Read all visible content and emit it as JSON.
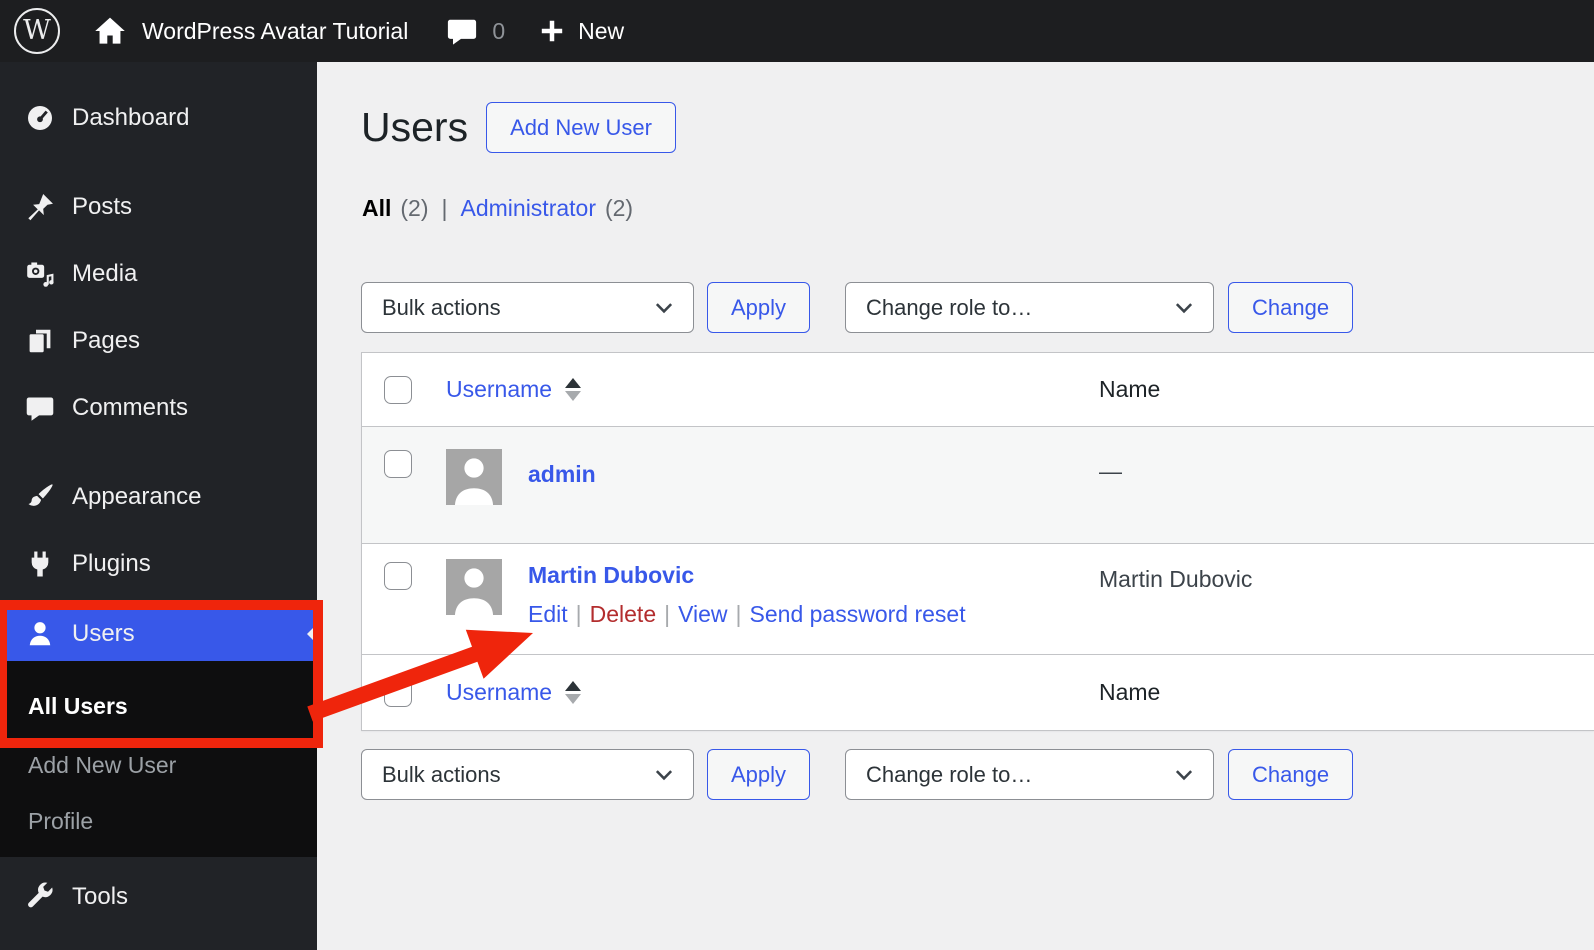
{
  "colors": {
    "accent": "#3858e9",
    "delete_red": "#b32d2e",
    "annotation_red": "#ef250c",
    "admin_bar_bg": "#1d1e20",
    "sidebar_bg": "#212327",
    "submenu_bg": "#0e0e0f",
    "content_bg": "#f0f0f1"
  },
  "admin_bar": {
    "site_name": "WordPress Avatar Tutorial",
    "comments_count": "0",
    "new_label": "New"
  },
  "sidebar": {
    "items": [
      {
        "label": "Dashboard",
        "icon": "dashboard-icon"
      },
      {
        "label": "Posts",
        "icon": "pushpin-icon"
      },
      {
        "label": "Media",
        "icon": "media-icon"
      },
      {
        "label": "Pages",
        "icon": "pages-icon"
      },
      {
        "label": "Comments",
        "icon": "comment-icon"
      },
      {
        "label": "Appearance",
        "icon": "brush-icon"
      },
      {
        "label": "Plugins",
        "icon": "plugin-icon"
      },
      {
        "label": "Users",
        "icon": "user-icon",
        "active": true
      },
      {
        "label": "Tools",
        "icon": "wrench-icon"
      }
    ],
    "users_submenu": [
      {
        "label": "All Users",
        "current": true
      },
      {
        "label": "Add New User"
      },
      {
        "label": "Profile"
      }
    ]
  },
  "page": {
    "title": "Users",
    "add_new_button": "Add New User",
    "filters": {
      "all": "All",
      "all_count": "(2)",
      "separator": "|",
      "administrator": "Administrator",
      "administrator_count": "(2)"
    },
    "toolbar": {
      "bulk_actions": "Bulk actions",
      "apply": "Apply",
      "change_role": "Change role to…",
      "change": "Change"
    },
    "table": {
      "columns": {
        "username": "Username",
        "name": "Name"
      },
      "rows": [
        {
          "username": "admin",
          "name": "—"
        },
        {
          "username": "Martin Dubovic",
          "name": "Martin Dubovic",
          "actions": {
            "edit": "Edit",
            "delete": "Delete",
            "view": "View",
            "reset": "Send password reset",
            "separator": "|"
          }
        }
      ]
    }
  }
}
